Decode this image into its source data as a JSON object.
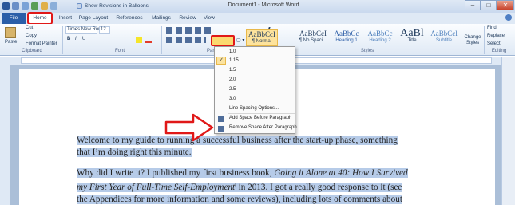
{
  "window": {
    "title": "Document1 - Microsoft Word"
  },
  "quick_access": {
    "show_revisions": "Show Revisions in Balloons"
  },
  "tabs": [
    "File",
    "Home",
    "Insert",
    "Page Layout",
    "References",
    "Mailings",
    "Review",
    "View"
  ],
  "clipboard": {
    "cut": "Cut",
    "copy": "Copy",
    "paste": "Paste",
    "format_painter": "Format Painter",
    "group": "Clipboard"
  },
  "font": {
    "name": "Times New Rom",
    "size": "12",
    "group": "Font",
    "bold": "B",
    "italic": "I",
    "underline": "U"
  },
  "paragraph": {
    "group": "Parag"
  },
  "styles": {
    "items": [
      {
        "preview": "AaBbCcI",
        "label": "¶ Normal"
      },
      {
        "preview": "AaBbCcI",
        "label": "¶ No Spaci..."
      },
      {
        "preview": "AaBbCc",
        "label": "Heading 1"
      },
      {
        "preview": "AaBbCc",
        "label": "Heading 2"
      },
      {
        "preview": "AaBl",
        "label": "Title"
      },
      {
        "preview": "AaBbCcl",
        "label": "Subtitle"
      }
    ],
    "change_styles": "Change Styles",
    "group": "Styles"
  },
  "editing": {
    "find": "Find",
    "replace": "Replace",
    "select": "Select",
    "group": "Editing"
  },
  "line_spacing_menu": {
    "options": [
      "1.0",
      "1.15",
      "1.5",
      "2.0",
      "2.5",
      "3.0"
    ],
    "selected": "1.15",
    "line_spacing_options": "Line Spacing Options...",
    "add_space_before": "Add Space Before Paragraph",
    "remove_space_after": "Remove Space After Paragraph"
  },
  "document": {
    "para1_a": "Welcome to my guide to running a successful business after the start-up phase, something",
    "para1_b": "that I’m doing right this minute.",
    "para2_a": "Why did I write it? I published my first business book, ",
    "para2_a_italic": "Going it Alone at 40: How I Survived",
    "para2_b_italic": "my First Year of Full-Time Self-Employment",
    "para2_b_sup": "i",
    "para2_b": " in 2013. I got a really good response to it (see",
    "para2_c": "the Appendices for more information and some reviews), including lots of comments about"
  }
}
